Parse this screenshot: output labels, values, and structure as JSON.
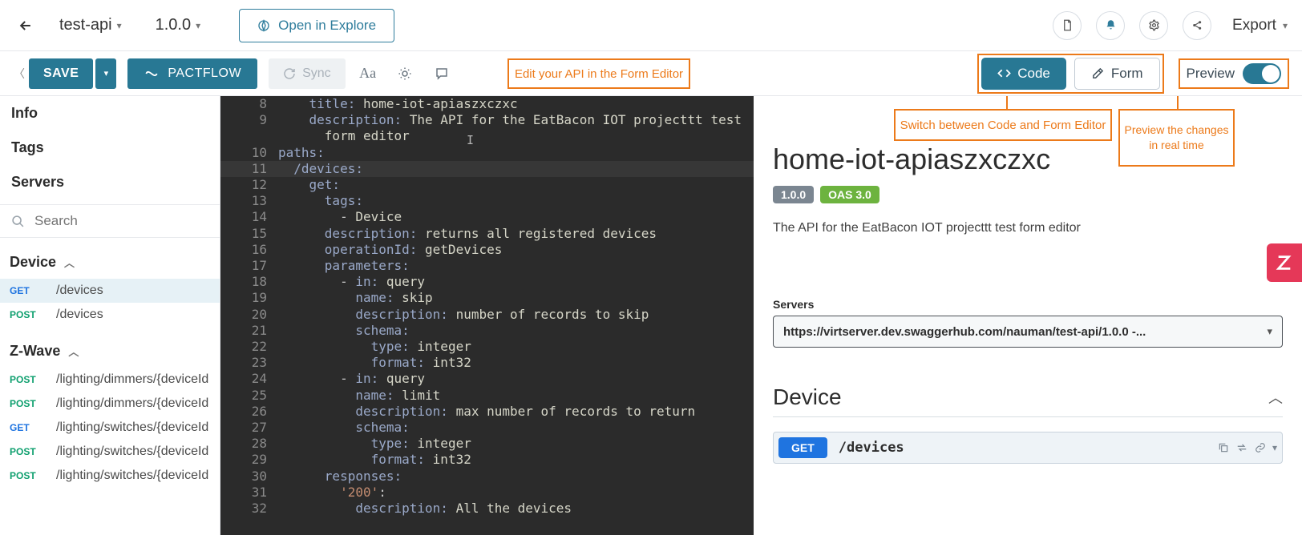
{
  "header": {
    "apiName": "test-api",
    "version": "1.0.0",
    "explore": "Open in Explore",
    "export": "Export"
  },
  "toolbar": {
    "save": "SAVE",
    "pactflow": "PACTFLOW",
    "sync": "Sync",
    "code": "Code",
    "form": "Form",
    "preview": "Preview"
  },
  "annotations": {
    "formEditor": "Edit your API in the Form Editor",
    "switch": "Switch between Code and Form Editor",
    "preview": "Preview the changes in real time"
  },
  "sidebar": {
    "info": "Info",
    "tags": "Tags",
    "servers": "Servers",
    "searchPlaceholder": "Search",
    "groups": [
      {
        "name": "Device",
        "items": [
          {
            "method": "GET",
            "path": "/devices",
            "selected": true
          },
          {
            "method": "POST",
            "path": "/devices"
          }
        ]
      },
      {
        "name": "Z-Wave",
        "items": [
          {
            "method": "POST",
            "path": "/lighting/dimmers/{deviceId"
          },
          {
            "method": "POST",
            "path": "/lighting/dimmers/{deviceId"
          },
          {
            "method": "GET",
            "path": "/lighting/switches/{deviceId"
          },
          {
            "method": "POST",
            "path": "/lighting/switches/{deviceId"
          },
          {
            "method": "POST",
            "path": "/lighting/switches/{deviceId"
          }
        ]
      }
    ]
  },
  "editor": {
    "lines": [
      {
        "n": 8,
        "html": "    <span class='k-key'>title:</span> <span class='k-str'>home-iot-apiaszxczxc</span>"
      },
      {
        "n": 9,
        "html": "    <span class='k-key'>description:</span> <span class='k-str'>The API for the EatBacon IOT projecttt test</span>"
      },
      {
        "n": "",
        "html": "      <span class='k-str'>form editor</span>"
      },
      {
        "n": 10,
        "html": "<span class='k-key'>paths:</span>"
      },
      {
        "n": 11,
        "html": "  <span class='k-key'>/devices:</span>",
        "hl": true
      },
      {
        "n": 12,
        "html": "    <span class='k-key'>get:</span>"
      },
      {
        "n": 13,
        "html": "      <span class='k-key'>tags:</span>"
      },
      {
        "n": 14,
        "html": "        - <span class='k-str'>Device</span>"
      },
      {
        "n": 15,
        "html": "      <span class='k-key'>description:</span> <span class='k-str'>returns all registered devices</span>"
      },
      {
        "n": 16,
        "html": "      <span class='k-key'>operationId:</span> <span class='k-str'>getDevices</span>"
      },
      {
        "n": 17,
        "html": "      <span class='k-key'>parameters:</span>"
      },
      {
        "n": 18,
        "html": "        - <span class='k-key'>in:</span> <span class='k-str'>query</span>"
      },
      {
        "n": 19,
        "html": "          <span class='k-key'>name:</span> <span class='k-str'>skip</span>"
      },
      {
        "n": 20,
        "html": "          <span class='k-key'>description:</span> <span class='k-str'>number of records to skip</span>"
      },
      {
        "n": 21,
        "html": "          <span class='k-key'>schema:</span>"
      },
      {
        "n": 22,
        "html": "            <span class='k-key'>type:</span> <span class='k-str'>integer</span>"
      },
      {
        "n": 23,
        "html": "            <span class='k-key'>format:</span> <span class='k-str'>int32</span>"
      },
      {
        "n": 24,
        "html": "        - <span class='k-key'>in:</span> <span class='k-str'>query</span>"
      },
      {
        "n": 25,
        "html": "          <span class='k-key'>name:</span> <span class='k-str'>limit</span>"
      },
      {
        "n": 26,
        "html": "          <span class='k-key'>description:</span> <span class='k-str'>max number of records to return</span>"
      },
      {
        "n": 27,
        "html": "          <span class='k-key'>schema:</span>"
      },
      {
        "n": 28,
        "html": "            <span class='k-key'>type:</span> <span class='k-str'>integer</span>"
      },
      {
        "n": 29,
        "html": "            <span class='k-key'>format:</span> <span class='k-str'>int32</span>"
      },
      {
        "n": 30,
        "html": "      <span class='k-key'>responses:</span>"
      },
      {
        "n": 31,
        "html": "        <span class='k-val'>'200'</span>:"
      },
      {
        "n": 32,
        "html": "          <span class='k-key'>description:</span> <span class='k-str'>All the devices</span>"
      }
    ]
  },
  "preview": {
    "title": "home-iot-apiaszxczxc",
    "versionBadge": "1.0.0",
    "oasBadge": "OAS 3.0",
    "description": "The API for the EatBacon IOT projecttt test form editor",
    "serversLabel": "Servers",
    "serverUrl": "https://virtserver.dev.swaggerhub.com/nauman/test-api/1.0.0 -...",
    "groupTitle": "Device",
    "op": {
      "method": "GET",
      "path": "/devices"
    }
  }
}
